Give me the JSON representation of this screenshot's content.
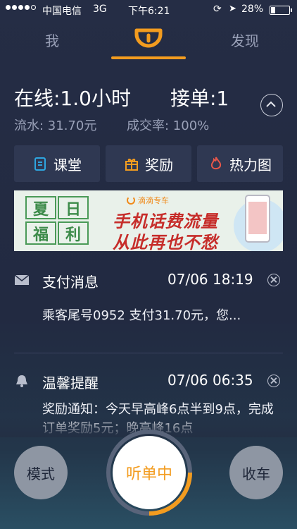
{
  "status_bar": {
    "carrier": "中国电信",
    "network": "3G",
    "time": "下午6:21",
    "battery_pct": "28%",
    "battery_level": 0.28
  },
  "nav": {
    "left_tab": "我",
    "right_tab": "发现",
    "logo_icon": "didi-logo-icon",
    "accent_color": "#f39c1f"
  },
  "stats": {
    "online": "在线:1.0小时",
    "orders": "接单:1",
    "flow": "流水: 31.70元",
    "rate": "成交率: 100%"
  },
  "quick_buttons": [
    {
      "label": "课堂",
      "icon": "clipboard-icon",
      "color": "#2ea6e0"
    },
    {
      "label": "奖励",
      "icon": "gift-icon",
      "color": "#f39c1f"
    },
    {
      "label": "热力图",
      "icon": "flame-icon",
      "color": "#e8574a"
    }
  ],
  "banner": {
    "tiles": [
      "夏",
      "日",
      "福",
      "利"
    ],
    "brand": "滴滴专车",
    "line1": "手机话费流量",
    "line2": "从此再也不愁"
  },
  "messages": [
    {
      "icon": "envelope-icon",
      "title": "支付消息",
      "time": "07/06 18:19",
      "body": "乘客尾号0952 支付31.70元，您..."
    },
    {
      "icon": "bell-icon",
      "title": "温馨提醒",
      "time": "07/06 06:35",
      "body": "奖励通知：今天早高峰6点半到9点，完成订单奖励5元；晚高峰16点"
    }
  ],
  "bottom": {
    "mode_label": "模式",
    "listen_label": "听单中",
    "stop_label": "收车"
  }
}
